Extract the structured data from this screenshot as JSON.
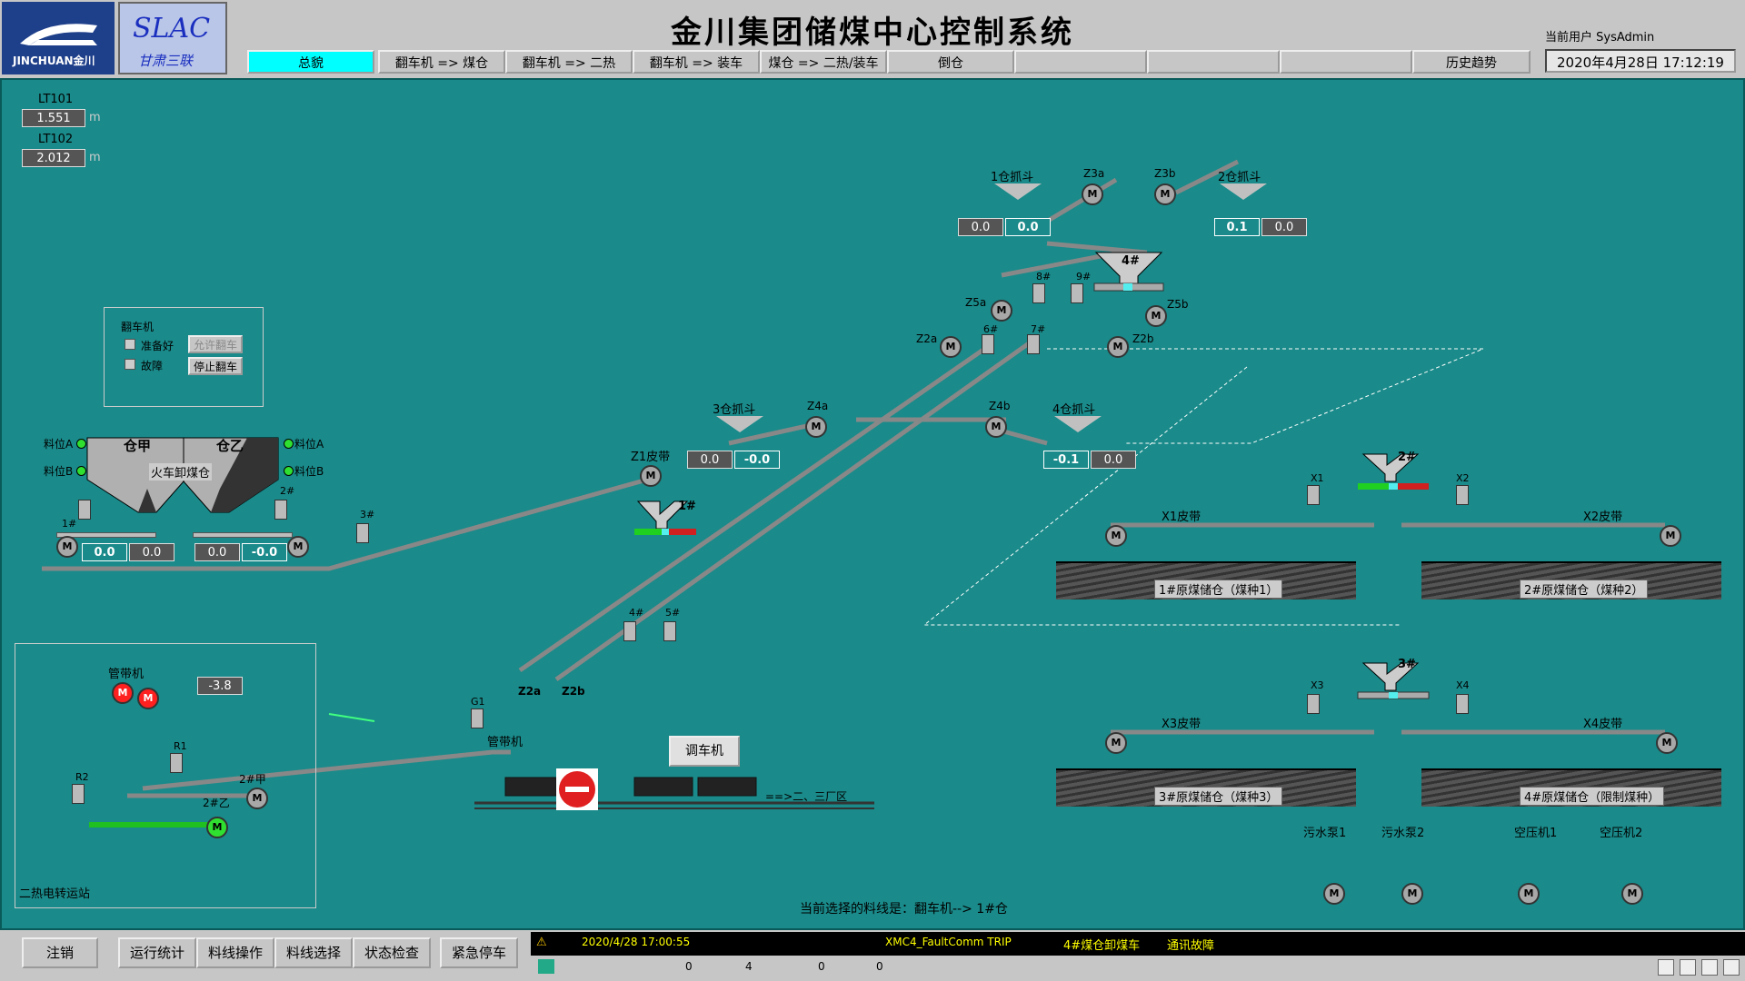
{
  "header": {
    "logo_text": "JINCHUAN金川",
    "slac_title": "SLAC",
    "slac_sub": "甘肃三联",
    "title": "金川集团储煤中心控制系统",
    "user_label": "当前用户 SysAdmin",
    "datetime": "2020年4月28日 17:12:19"
  },
  "nav": [
    "总貌",
    "翻车机 => 煤仓",
    "翻车机 => 二热",
    "翻车机 => 装车",
    "煤仓 => 二热/装车",
    "倒仓",
    "",
    "",
    "",
    "历史趋势",
    ""
  ],
  "levels": {
    "lt101_label": "LT101",
    "lt101_value": "1.551",
    "lt102_label": "LT102",
    "lt102_value": "2.012",
    "unit": "m"
  },
  "dumper_panel": {
    "title": "翻车机",
    "cb1": "准备好",
    "cb2": "故障",
    "btn_allow": "允许翻车",
    "btn_stop": "停止翻车"
  },
  "unload_bin": {
    "left": "仓甲",
    "right": "仓乙",
    "name": "火车卸煤仓",
    "level_a_left": "料位A",
    "level_b_left": "料位B",
    "level_a_right": "料位A",
    "level_b_right": "料位B",
    "v1": "0.0",
    "v2": "0.0",
    "v3": "0.0",
    "v4": "-0.0",
    "f1": "1#",
    "f2": "2#",
    "f3": "3#"
  },
  "grabs": {
    "g1": "1仓抓斗",
    "g2": "2仓抓斗",
    "g3": "3仓抓斗",
    "g4": "4仓抓斗",
    "g1v1": "0.0",
    "g1v2": "0.0",
    "g2v1": "0.1",
    "g2v2": "0.0",
    "g3v1": "0.0",
    "g3v2": "-0.0",
    "g4v1": "-0.1",
    "g4v2": "0.0"
  },
  "conveyors": {
    "z1": "Z1皮带",
    "z2a": "Z2a",
    "z2b": "Z2b",
    "z2a_low": "Z2a",
    "z2b_low": "Z2b",
    "z3a": "Z3a",
    "z3b": "Z3b",
    "z4a": "Z4a",
    "z4b": "Z4b",
    "z5a": "Z5a",
    "z5b": "Z5b",
    "x1": "X1皮带",
    "x2": "X2皮带",
    "x3": "X3皮带",
    "x4": "X4皮带",
    "d4": "4#",
    "d1": "1#",
    "d2": "2#",
    "d3": "3#",
    "f6": "6#",
    "f7": "7#",
    "f8": "8#",
    "f9": "9#",
    "f4": "4#",
    "f5": "5#",
    "x1s": "X1",
    "x2s": "X2",
    "x3s": "X3",
    "x4s": "X4",
    "g1s": "G1",
    "pipe_belt": "管带机"
  },
  "storage": {
    "s1": "1#原煤储仓（煤种1）",
    "s2": "2#原煤储仓（煤种2）",
    "s3": "3#原煤储仓（煤种3）",
    "s4": "4#原煤储仓（限制煤种）"
  },
  "rail": {
    "shunter": "调车机",
    "dest": "==>二、三厂区"
  },
  "transfer_station": {
    "title": "二热电转运站",
    "pipe": "管带机",
    "pipe_value": "-3.8",
    "r1": "R1",
    "r2": "R2",
    "b2a": "2#甲",
    "b2b": "2#乙"
  },
  "equipment": {
    "pump1": "污水泵1",
    "pump2": "污水泵2",
    "comp1": "空压机1",
    "comp2": "空压机2"
  },
  "current_line": "当前选择的料线是：翻车机--> 1#仓",
  "bottom": {
    "buttons": [
      "注销",
      "运行统计",
      "料线操作",
      "料线选择",
      "状态检查",
      "紧急停车"
    ]
  },
  "alarm": {
    "time": "2020/4/28 17:00:55",
    "tag": "XMC4_FaultComm TRIP",
    "desc": "4#煤仓卸煤车",
    "status": "通讯故障",
    "c1": "0",
    "c2": "4",
    "c3": "0",
    "c4": "0"
  },
  "colors": {
    "background": "#1a8a8a",
    "active_nav": "#00ffff",
    "alarm_text": "#ffff00"
  }
}
